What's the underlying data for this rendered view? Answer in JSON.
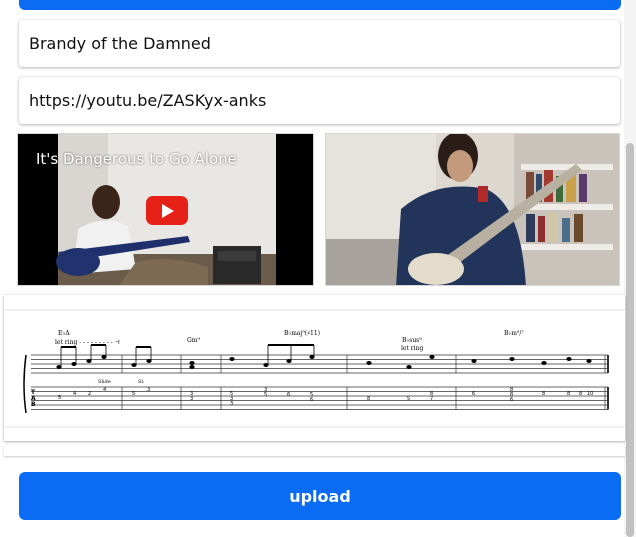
{
  "form": {
    "title_value": "Brandy of the Damned",
    "url_value": "https://youtu.be/ZASKyx-anks",
    "upload_label": "upload"
  },
  "video": {
    "title": "It's Dangerous to Go Alone"
  },
  "tab": {
    "chord_1": "E♭Δ",
    "let_ring_1": "let ring - - - - - - - - - ⊣",
    "chord_2": "Gm⁹",
    "chord_3": "B♭maj⁹(♯11)",
    "chord_4": "B♭sus⁹",
    "let_ring_2": "let ring",
    "chord_5": "B♭m⁹/⁷",
    "slide_label": "Slide",
    "sl_label": "Sl.",
    "staff_labels": [
      "T",
      "A",
      "B"
    ],
    "fret_numbers": [
      "5",
      "4",
      "2",
      "4",
      "5",
      "3",
      "3",
      "3",
      "5",
      "3",
      "3",
      "3",
      "5",
      "6",
      "5",
      "6",
      "8",
      "5",
      "8",
      "7",
      "6",
      "8",
      "8",
      "8",
      "6",
      "8",
      "8",
      "10"
    ]
  },
  "colors": {
    "accent": "#0a6cf5",
    "play_button": "#e62117"
  },
  "icons": {
    "play": "youtube-play-icon"
  }
}
